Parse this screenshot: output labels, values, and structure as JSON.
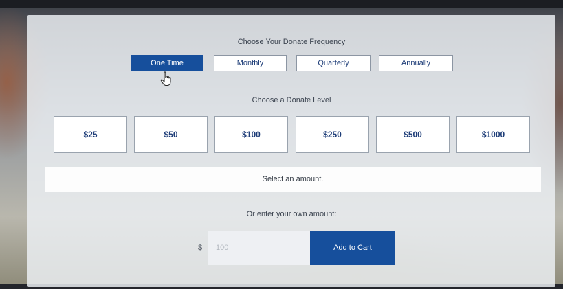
{
  "frequency": {
    "heading": "Choose Your Donate Frequency",
    "options": [
      {
        "label": "One Time",
        "selected": true
      },
      {
        "label": "Monthly",
        "selected": false
      },
      {
        "label": "Quarterly",
        "selected": false
      },
      {
        "label": "Annually",
        "selected": false
      }
    ]
  },
  "level": {
    "heading": "Choose a Donate Level",
    "amounts": [
      "$25",
      "$50",
      "$100",
      "$250",
      "$500",
      "$1000"
    ]
  },
  "status": {
    "message": "Select an amount."
  },
  "custom_amount": {
    "label": "Or enter your own amount:",
    "currency_symbol": "$",
    "placeholder": "100",
    "value": ""
  },
  "actions": {
    "add_to_cart_label": "Add to Cart"
  },
  "colors": {
    "primary": "#164f9c",
    "button_text": "#1e3d78",
    "panel_bg": "#eceff3"
  },
  "icons": {
    "cursor": "hand-pointer-icon"
  }
}
